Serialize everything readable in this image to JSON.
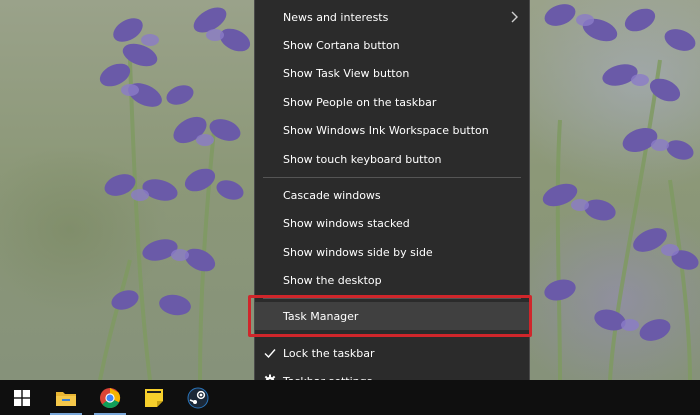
{
  "context_menu": {
    "news_and_interests": "News and interests",
    "show_cortana": "Show Cortana button",
    "show_task_view": "Show Task View button",
    "show_people": "Show People on the taskbar",
    "show_ink_workspace": "Show Windows Ink Workspace button",
    "show_touch_keyboard": "Show touch keyboard button",
    "cascade_windows": "Cascade windows",
    "show_windows_stacked": "Show windows stacked",
    "show_windows_side_by_side": "Show windows side by side",
    "show_desktop": "Show the desktop",
    "task_manager": "Task Manager",
    "lock_taskbar": "Lock the taskbar",
    "taskbar_settings": "Taskbar settings"
  },
  "icons": {
    "submenu": "chevron-right-icon",
    "checked": "checkmark-icon",
    "settings": "gear-icon",
    "start": "windows-logo-icon",
    "file_explorer": "folder-icon",
    "browser": "chrome-icon",
    "notes": "sticky-notes-icon",
    "steam": "steam-icon"
  },
  "colors": {
    "menu_bg": "#2b2b2b",
    "menu_hover": "#404040",
    "highlight_box": "#d0262b",
    "taskbar_bg": "#0f0f0f"
  }
}
